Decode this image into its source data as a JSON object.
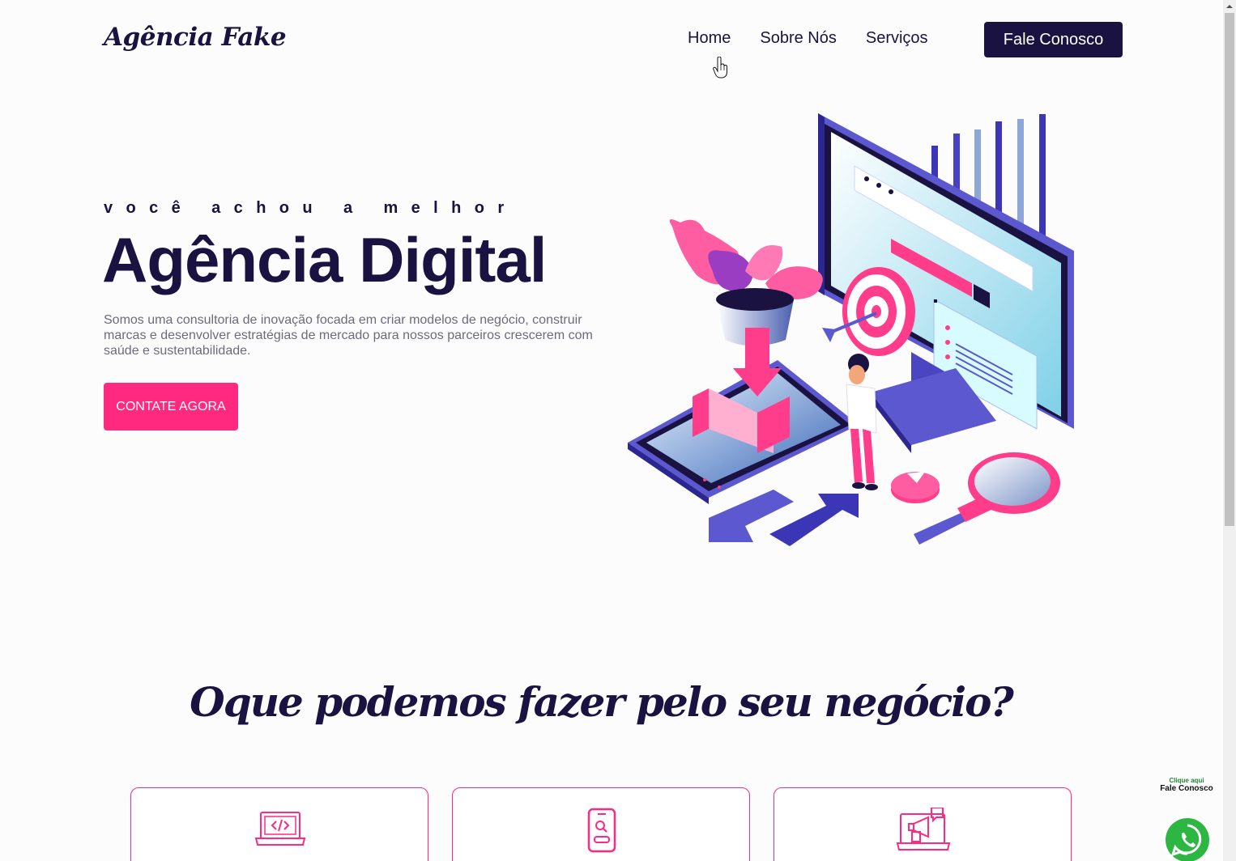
{
  "header": {
    "logo": "Agência Fake",
    "nav": [
      "Home",
      "Sobre Nós",
      "Serviços"
    ],
    "cta": "Fale Conosco"
  },
  "hero": {
    "kicker": "você achou a melhor",
    "title": "Agência Digital",
    "description": "Somos uma consultoria de inovação focada em criar modelos de negócio, construir marcas e desenvolver estratégias de mercado para nossos parceiros crescerem com saúde e sustentabilidade.",
    "button": "CONTATE AGORA"
  },
  "services": {
    "title": "Oque podemos fazer pelo seu negócio?",
    "cards": [
      {
        "icon": "laptop-code-icon"
      },
      {
        "icon": "smartphone-search-icon"
      },
      {
        "icon": "marketing-megaphone-icon"
      }
    ]
  },
  "whatsapp": {
    "small": "Clique aqui",
    "big": "Fale Conosco",
    "icon": "whatsapp-icon"
  },
  "colors": {
    "navy": "#1a1240",
    "pink": "#ff2a7f",
    "purple": "#5b4fcf"
  }
}
